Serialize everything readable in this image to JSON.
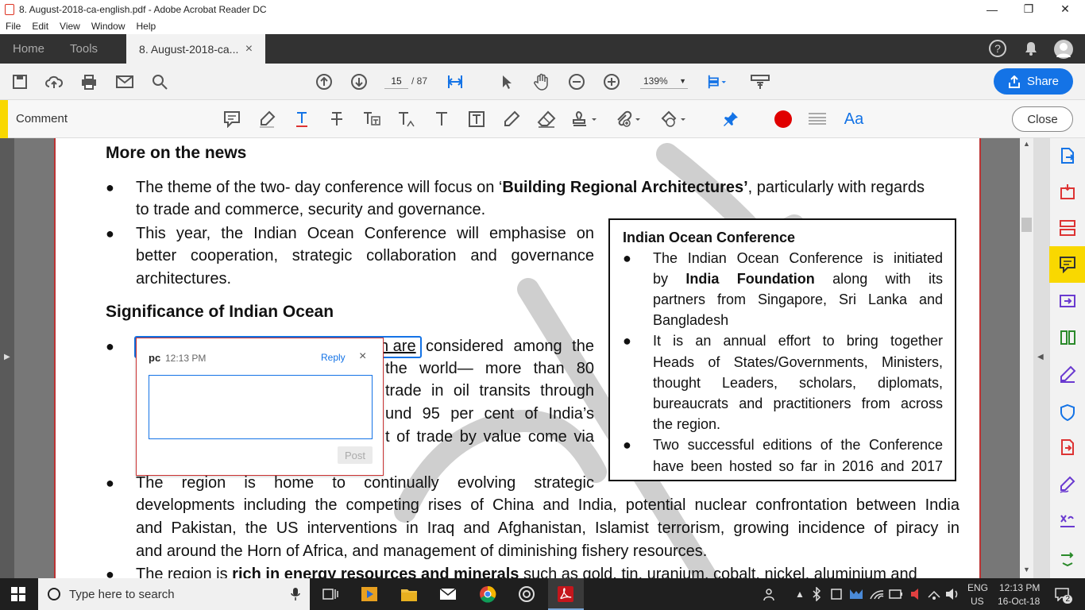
{
  "window": {
    "title": "8. August-2018-ca-english.pdf - Adobe Acrobat Reader DC",
    "minimize": "—",
    "maximize": "❐",
    "close": "✕"
  },
  "menu": [
    "File",
    "Edit",
    "View",
    "Window",
    "Help"
  ],
  "tabs": {
    "home": "Home",
    "tools": "Tools",
    "document": "8. August-2018-ca...",
    "close": "×"
  },
  "toolbar": {
    "page_current": "15",
    "page_total": "/ 87",
    "zoom": "139%",
    "share": "Share"
  },
  "comment_bar": {
    "label": "Comment",
    "close": "Close",
    "accent_color": "#f9d800",
    "color_swatch": "#e00000"
  },
  "document": {
    "heading1": "More on the news",
    "b1_l1a": "The theme of the two- day conference will focus on ‘",
    "b1_l1b": "Building Regional Architectures’",
    "b1_l1c": ", particularly with regards",
    "b1_l2": "to trade and commerce, security and governance.",
    "b2_l1": "This year, the Indian Ocean Conference will emphasise on",
    "b2_l2": "better cooperation, strategic collaboration and governance",
    "b2_l3": "architectures.",
    "heading2": "Significance of Indian Ocean",
    "b3_l1a": "n are",
    "b3_l1b": "considered among the",
    "b3_l2": "the world— more than 80",
    "b3_l3": "trade in oil transits through",
    "b3_l4": "und 95 per cent of India’s",
    "b3_l5": "t of trade by value come via",
    "b4_l1": "The region is home to continually evolving strategic",
    "b4_l2": "developments including the competing rises of China and India, potential nuclear confrontation between India",
    "b4_l3": "and Pakistan, the US interventions in Iraq and Afghanistan, Islamist terrorism, growing incidence of piracy in",
    "b4_l4": "and around the Horn of Africa, and management of diminishing fishery resources.",
    "b5_l1a": "The region is ",
    "b5_l1b": "rich in energy resources and minerals",
    "b5_l1c": " such as gold, tin, uranium, cobalt, nickel, aluminium and"
  },
  "sidebox": {
    "title": "Indian Ocean Conference",
    "s1_l1": "The Indian Ocean Conference is initiated",
    "s1_l2a": "by ",
    "s1_l2b": "India Foundation",
    "s1_l2c": " along with its",
    "s1_l3": "partners from Singapore, Sri Lanka and",
    "s1_l4": "Bangladesh",
    "s2_l1": "It is an annual effort to bring together",
    "s2_l2": "Heads of States/Governments, Ministers,",
    "s2_l3": "thought Leaders, scholars, diplomats,",
    "s2_l4": "bureaucrats and practitioners from across",
    "s2_l5": "the region.",
    "s3_l1": "Two successful editions of the Conference",
    "s3_l2": "have been hosted so far in 2016 and 2017"
  },
  "comment_popup": {
    "author": "pc",
    "time": "12:13 PM",
    "reply": "Reply",
    "close": "×",
    "text": "",
    "post": "Post"
  },
  "taskbar": {
    "search_placeholder": "Type here to search",
    "lang_top": "ENG",
    "lang_bottom": "US",
    "time": "12:13 PM",
    "date": "16-Oct-18",
    "notification_count": "2"
  }
}
